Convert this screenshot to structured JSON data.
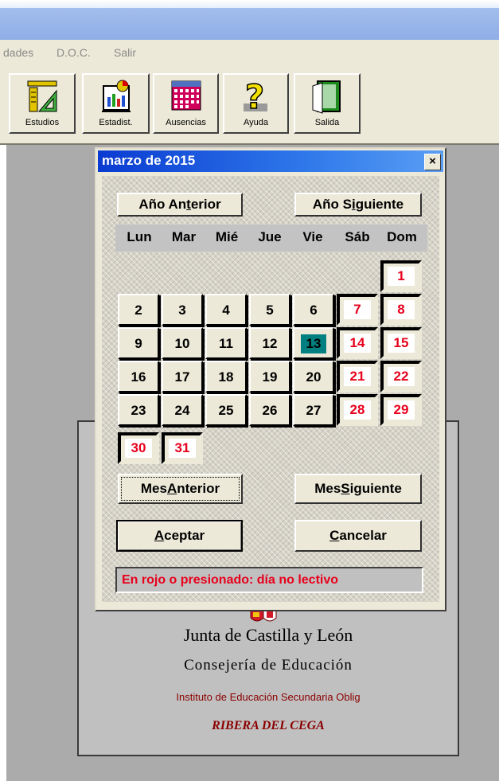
{
  "menu": {
    "items": [
      "dades",
      "D.O.C.",
      "Salir"
    ]
  },
  "toolbar": {
    "buttons": [
      {
        "label": "Estudios",
        "icon": "ruler-triangle-icon"
      },
      {
        "label": "Estadist.",
        "icon": "bar-chart-icon"
      },
      {
        "label": "Ausencias",
        "icon": "calendar-grid-icon"
      },
      {
        "label": "Ayuda",
        "icon": "question-mark-icon"
      },
      {
        "label": "Salida",
        "icon": "exit-door-icon"
      }
    ]
  },
  "splash": {
    "org": "Junta de Castilla y León",
    "dept": "Consejería de Educación",
    "school": "Instituto de Educación Secundaria Oblig",
    "name": "RIBERA DEL CEGA"
  },
  "dialog": {
    "title": "marzo de 2015",
    "close": "×",
    "prev_year_pre": "Año An",
    "prev_year_key": "t",
    "prev_year_post": "erior",
    "next_year_pre": "Año S",
    "next_year_key": "i",
    "next_year_post": "guiente",
    "weekdays": [
      "Lun",
      "Mar",
      "Mié",
      "Jue",
      "Vie",
      "Sáb",
      "Dom"
    ],
    "days": [
      "1",
      "2",
      "3",
      "4",
      "5",
      "6",
      "7",
      "8",
      "9",
      "10",
      "11",
      "12",
      "13",
      "14",
      "15",
      "16",
      "17",
      "18",
      "19",
      "20",
      "21",
      "22",
      "23",
      "24",
      "25",
      "26",
      "27",
      "28",
      "29",
      "30",
      "31"
    ],
    "red_days": [
      1,
      7,
      8,
      14,
      15,
      21,
      22,
      28,
      29,
      30,
      31
    ],
    "today": 13,
    "prev_month_pre": "Mes ",
    "prev_month_key": "A",
    "prev_month_post": "nterior",
    "next_month_pre": "Mes ",
    "next_month_key": "S",
    "next_month_post": "iguiente",
    "accept_key": "A",
    "accept_post": "ceptar",
    "cancel_key": "C",
    "cancel_post": "ancelar",
    "note": "En rojo o presionado: día no lectivo"
  },
  "colors": {
    "holiday": "#e8001c",
    "today": "#008080",
    "title_bar": "#0a3bd1"
  }
}
